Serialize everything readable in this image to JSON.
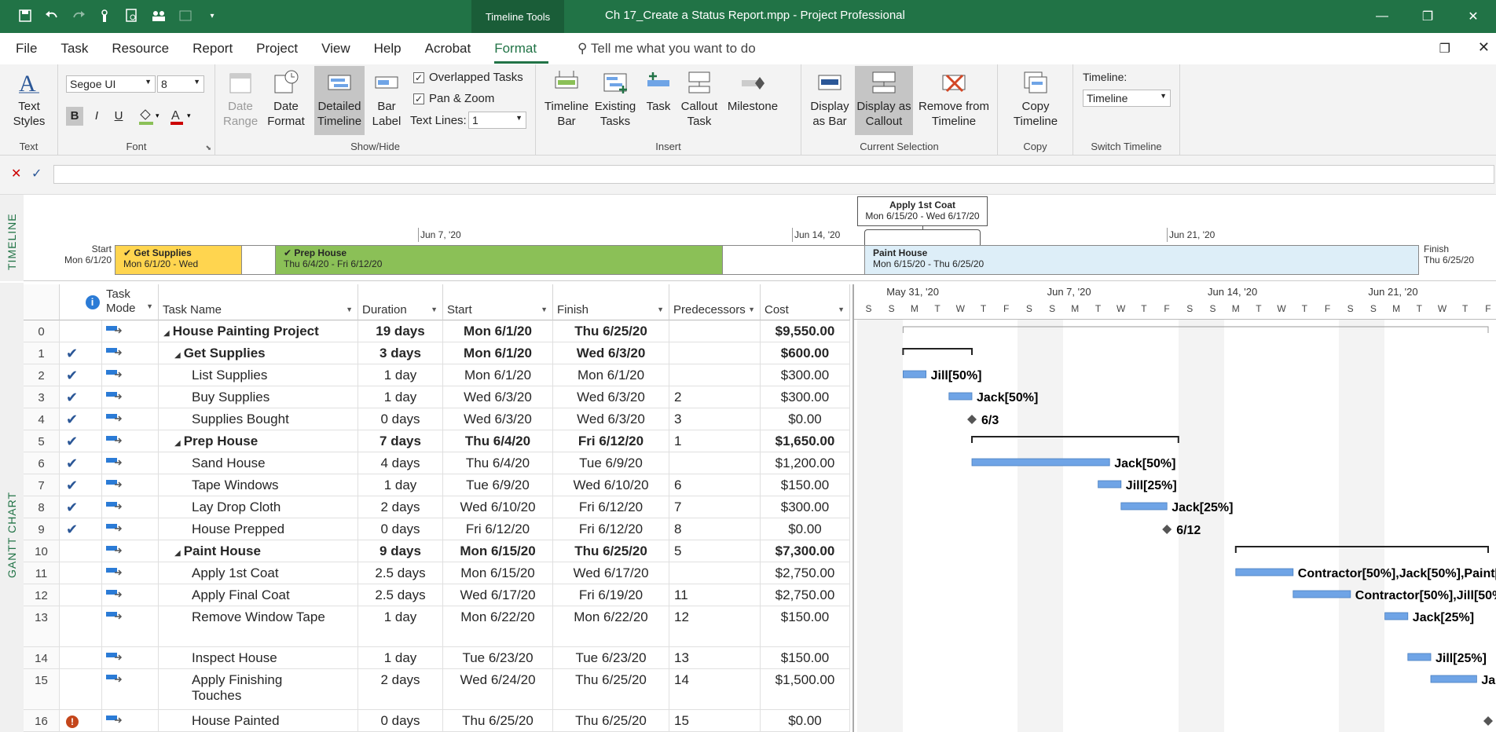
{
  "titlebar": {
    "tools_tab": "Timeline Tools",
    "doc_title": "Ch 17_Create a Status Report.mpp  -  Project Professional"
  },
  "menu": {
    "tabs": [
      "File",
      "Task",
      "Resource",
      "Report",
      "Project",
      "View",
      "Help",
      "Acrobat",
      "Format"
    ],
    "active": "Format",
    "tell_me": "Tell me what you want to do"
  },
  "ribbon": {
    "text_group": {
      "label": "Text",
      "text_styles": "Text Styles"
    },
    "font_group": {
      "label": "Font",
      "font_name": "Segoe UI",
      "font_size": "8",
      "bold": "B",
      "italic": "I",
      "underline": "U"
    },
    "showhide_group": {
      "label": "Show/Hide",
      "date_range": "Date Range",
      "date_format": "Date Format",
      "detailed_timeline": "Detailed Timeline",
      "bar_label": "Bar Label",
      "overlapped_tasks": "Overlapped Tasks",
      "pan_zoom": "Pan & Zoom",
      "text_lines_label": "Text Lines:",
      "text_lines_value": "1"
    },
    "insert_group": {
      "label": "Insert",
      "timeline_bar": "Timeline Bar",
      "existing_tasks": "Existing Tasks",
      "task": "Task",
      "callout_task": "Callout Task",
      "milestone": "Milestone"
    },
    "selection_group": {
      "label": "Current Selection",
      "display_as_bar": "Display as Bar",
      "display_as_callout": "Display as Callout",
      "remove_from_timeline": "Remove from Timeline"
    },
    "copy_group": {
      "label": "Copy",
      "copy_timeline": "Copy Timeline"
    },
    "switch_group": {
      "label": "Switch Timeline",
      "timeline_label": "Timeline:",
      "timeline_value": "Timeline"
    }
  },
  "timeline": {
    "side_label": "TIMELINE",
    "start_label": "Start",
    "start_date": "Mon 6/1/20",
    "finish_label": "Finish",
    "finish_date": "Thu 6/25/20",
    "scale": [
      "Jun 7, '20",
      "Jun 14, '20",
      "Jun 21, '20"
    ],
    "bars": [
      {
        "name": "Get Supplies",
        "dates": "Mon 6/1/20 - Wed",
        "color": "#ffd54f"
      },
      {
        "name": "Prep House",
        "dates": "Thu 6/4/20 - Fri 6/12/20",
        "color": "#8bc057"
      },
      {
        "name": "Paint House",
        "dates": "Mon 6/15/20 - Thu 6/25/20",
        "color": "#ddeef8"
      }
    ],
    "callout": {
      "name": "Apply 1st Coat",
      "dates": "Mon 6/15/20 - Wed 6/17/20"
    }
  },
  "gantt": {
    "side_label": "GANTT CHART",
    "headers": [
      "",
      "Task Mode",
      "Task Name",
      "Duration",
      "Start",
      "Finish",
      "Predecessors",
      "Cost"
    ],
    "rows": [
      {
        "id": "0",
        "info": "",
        "name": "House Painting Project",
        "duration": "19 days",
        "start": "Mon 6/1/20",
        "finish": "Thu 6/25/20",
        "pred": "",
        "cost": "$9,550.00",
        "level": 0,
        "summary": true
      },
      {
        "id": "1",
        "info": "check",
        "name": "Get Supplies",
        "duration": "3 days",
        "start": "Mon 6/1/20",
        "finish": "Wed 6/3/20",
        "pred": "",
        "cost": "$600.00",
        "level": 1,
        "summary": true
      },
      {
        "id": "2",
        "info": "check",
        "name": "List Supplies",
        "duration": "1 day",
        "start": "Mon 6/1/20",
        "finish": "Mon 6/1/20",
        "pred": "",
        "cost": "$300.00",
        "level": 2,
        "summary": false
      },
      {
        "id": "3",
        "info": "check",
        "name": "Buy Supplies",
        "duration": "1 day",
        "start": "Wed 6/3/20",
        "finish": "Wed 6/3/20",
        "pred": "2",
        "cost": "$300.00",
        "level": 2,
        "summary": false
      },
      {
        "id": "4",
        "info": "check",
        "name": "Supplies Bought",
        "duration": "0 days",
        "start": "Wed 6/3/20",
        "finish": "Wed 6/3/20",
        "pred": "3",
        "cost": "$0.00",
        "level": 2,
        "summary": false
      },
      {
        "id": "5",
        "info": "check",
        "name": "Prep House",
        "duration": "7 days",
        "start": "Thu 6/4/20",
        "finish": "Fri 6/12/20",
        "pred": "1",
        "cost": "$1,650.00",
        "level": 1,
        "summary": true
      },
      {
        "id": "6",
        "info": "check",
        "name": "Sand House",
        "duration": "4 days",
        "start": "Thu 6/4/20",
        "finish": "Tue 6/9/20",
        "pred": "",
        "cost": "$1,200.00",
        "level": 2,
        "summary": false
      },
      {
        "id": "7",
        "info": "check",
        "name": "Tape Windows",
        "duration": "1 day",
        "start": "Tue 6/9/20",
        "finish": "Wed 6/10/20",
        "pred": "6",
        "cost": "$150.00",
        "level": 2,
        "summary": false
      },
      {
        "id": "8",
        "info": "check",
        "name": "Lay Drop Cloth",
        "duration": "2 days",
        "start": "Wed 6/10/20",
        "finish": "Fri 6/12/20",
        "pred": "7",
        "cost": "$300.00",
        "level": 2,
        "summary": false
      },
      {
        "id": "9",
        "info": "check",
        "name": "House Prepped",
        "duration": "0 days",
        "start": "Fri 6/12/20",
        "finish": "Fri 6/12/20",
        "pred": "8",
        "cost": "$0.00",
        "level": 2,
        "summary": false
      },
      {
        "id": "10",
        "info": "",
        "name": "Paint House",
        "duration": "9 days",
        "start": "Mon 6/15/20",
        "finish": "Thu 6/25/20",
        "pred": "5",
        "cost": "$7,300.00",
        "level": 1,
        "summary": true
      },
      {
        "id": "11",
        "info": "",
        "name": "Apply 1st Coat",
        "duration": "2.5 days",
        "start": "Mon 6/15/20",
        "finish": "Wed 6/17/20",
        "pred": "",
        "cost": "$2,750.00",
        "level": 2,
        "summary": false
      },
      {
        "id": "12",
        "info": "",
        "name": "Apply Final Coat",
        "duration": "2.5 days",
        "start": "Wed 6/17/20",
        "finish": "Fri 6/19/20",
        "pred": "11",
        "cost": "$2,750.00",
        "level": 2,
        "summary": false
      },
      {
        "id": "13",
        "info": "",
        "name": "Remove Window Tape",
        "duration": "1 day",
        "start": "Mon 6/22/20",
        "finish": "Mon 6/22/20",
        "pred": "12",
        "cost": "$150.00",
        "level": 2,
        "summary": false
      },
      {
        "id": "14",
        "info": "",
        "name": "Inspect House",
        "duration": "1 day",
        "start": "Tue 6/23/20",
        "finish": "Tue 6/23/20",
        "pred": "13",
        "cost": "$150.00",
        "level": 2,
        "summary": false
      },
      {
        "id": "15",
        "info": "",
        "name": "Apply Finishing Touches",
        "name_line1": "Apply Finishing",
        "name_line2": "Touches",
        "duration": "2 days",
        "start": "Wed 6/24/20",
        "finish": "Thu 6/25/20",
        "pred": "14",
        "cost": "$1,500.00",
        "level": 2,
        "summary": false
      },
      {
        "id": "16",
        "info": "warn",
        "name": "House Painted",
        "duration": "0 days",
        "start": "Thu 6/25/20",
        "finish": "Thu 6/25/20",
        "pred": "15",
        "cost": "$0.00",
        "level": 2,
        "summary": false
      }
    ],
    "chart_weeks": [
      "May 31, '20",
      "Jun 7, '20",
      "Jun 14, '20",
      "Jun 21, '20"
    ],
    "chart_days": [
      "S",
      "S",
      "M",
      "T",
      "W",
      "T",
      "F",
      "S",
      "S",
      "M",
      "T",
      "W",
      "T",
      "F",
      "S",
      "S",
      "M",
      "T",
      "W",
      "T",
      "F",
      "S",
      "S",
      "M",
      "T",
      "W",
      "T",
      "F"
    ],
    "bar_labels": [
      "Jill[50%]",
      "Jack[50%]",
      "6/3",
      "Jack[50%]",
      "Jill[25%]",
      "Jack[25%]",
      "6/12",
      "Contractor[50%],Jack[50%],Paint[",
      "Contractor[50%],Jill[50%",
      "Jack[25%]",
      "Jill[25%]",
      "Jac",
      "6/"
    ]
  }
}
